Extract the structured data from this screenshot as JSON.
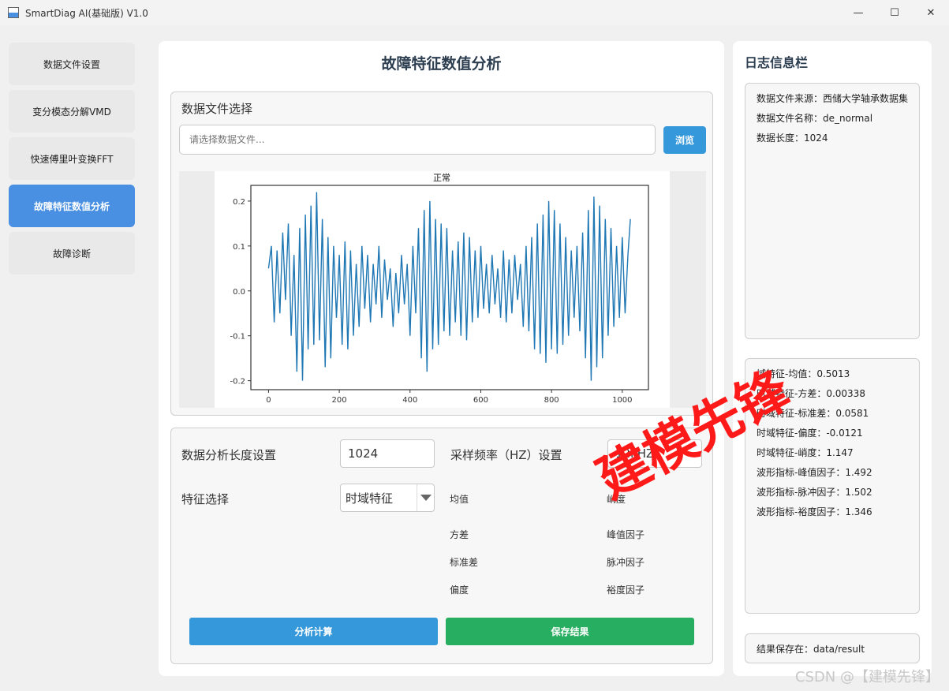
{
  "window": {
    "title": "SmartDiag AI(基础版) V1.0",
    "minimize": "—",
    "maximize": "☐",
    "close": "✕"
  },
  "sidebar": {
    "items": [
      {
        "label": "数据文件设置",
        "active": false
      },
      {
        "label": "变分模态分解VMD",
        "active": false
      },
      {
        "label": "快速傅里叶变换FFT",
        "active": false
      },
      {
        "label": "故障特征数值分析",
        "active": true
      },
      {
        "label": "故障诊断",
        "active": false
      }
    ]
  },
  "main": {
    "title": "故障特征数值分析",
    "file_section": {
      "title": "数据文件选择",
      "input_placeholder": "请选择数据文件...",
      "browse_label": "浏览"
    },
    "settings": {
      "length_label": "数据分析长度设置",
      "length_value": "1024",
      "freq_label": "采样频率（HZ）设置",
      "freq_value": "12kHZ",
      "feature_label": "特征选择",
      "feature_selected": "时域特征",
      "features_left": [
        "均值",
        "方差",
        "标准差",
        "偏度"
      ],
      "features_right": [
        "峭度",
        "峰值因子",
        "脉冲因子",
        "裕度因子"
      ],
      "analyze_label": "分析计算",
      "save_label": "保存结果"
    }
  },
  "log": {
    "title": "日志信息栏",
    "file_info": [
      "数据文件来源：西储大学轴承数据集",
      "数据文件名称：de_normal",
      "数据长度：1024"
    ],
    "results": [
      "域特征-均值：0.5013",
      "时域特征-方差：0.00338",
      "时域特征-标准差：0.0581",
      "时域特征-偏度：-0.0121",
      "时域特征-峭度：1.147",
      "波形指标-峰值因子：1.492",
      "波形指标-脉冲因子：1.502",
      "波形指标-裕度因子：1.346"
    ],
    "save_path": "结果保存在：data/result"
  },
  "watermark": "建模先锋",
  "csdn_mark": "CSDN @【建模先锋】",
  "colors": {
    "primary": "#3498db",
    "active_nav": "#4a90e2",
    "save": "#27ae60",
    "line": "#1f77b4"
  },
  "chart_data": {
    "type": "line",
    "title": "正常",
    "xlabel": "",
    "ylabel": "",
    "xlim": [
      -50,
      1074
    ],
    "ylim": [
      -0.22,
      0.235
    ],
    "xticks": [
      0,
      200,
      400,
      600,
      800,
      1000
    ],
    "yticks": [
      0.2,
      0.1,
      0.0,
      -0.1,
      -0.2
    ],
    "x": [
      0,
      8,
      16,
      24,
      32,
      40,
      48,
      56,
      64,
      72,
      80,
      88,
      96,
      104,
      112,
      120,
      128,
      136,
      144,
      152,
      160,
      168,
      176,
      184,
      192,
      200,
      208,
      216,
      224,
      232,
      240,
      248,
      256,
      264,
      272,
      280,
      288,
      296,
      304,
      312,
      320,
      328,
      336,
      344,
      352,
      360,
      368,
      376,
      384,
      392,
      400,
      408,
      416,
      424,
      432,
      440,
      448,
      456,
      464,
      472,
      480,
      488,
      496,
      504,
      512,
      520,
      528,
      536,
      544,
      552,
      560,
      568,
      576,
      584,
      592,
      600,
      608,
      616,
      624,
      632,
      640,
      648,
      656,
      664,
      672,
      680,
      688,
      696,
      704,
      712,
      720,
      728,
      736,
      744,
      752,
      760,
      768,
      776,
      784,
      792,
      800,
      808,
      816,
      824,
      832,
      840,
      848,
      856,
      864,
      872,
      880,
      888,
      896,
      904,
      912,
      920,
      928,
      936,
      944,
      952,
      960,
      968,
      976,
      984,
      992,
      1000,
      1008,
      1016,
      1023
    ],
    "y": [
      0.05,
      0.1,
      -0.07,
      0.09,
      -0.05,
      0.13,
      -0.02,
      0.15,
      -0.1,
      0.08,
      -0.18,
      0.14,
      -0.2,
      0.17,
      -0.13,
      0.19,
      -0.12,
      0.22,
      -0.11,
      0.16,
      -0.17,
      0.12,
      -0.15,
      0.1,
      -0.06,
      0.08,
      -0.12,
      0.11,
      -0.13,
      0.09,
      -0.1,
      0.06,
      -0.08,
      0.1,
      -0.04,
      0.08,
      -0.07,
      0.06,
      -0.03,
      0.1,
      -0.06,
      0.07,
      -0.02,
      0.05,
      -0.08,
      0.04,
      -0.05,
      0.08,
      -0.03,
      0.06,
      -0.1,
      0.1,
      -0.05,
      0.14,
      -0.15,
      0.18,
      -0.18,
      0.2,
      -0.13,
      0.16,
      -0.12,
      0.15,
      -0.09,
      0.14,
      -0.1,
      0.09,
      -0.07,
      0.11,
      -0.1,
      0.13,
      -0.11,
      0.12,
      -0.07,
      0.09,
      -0.06,
      0.1,
      -0.04,
      0.06,
      -0.05,
      0.08,
      -0.03,
      0.05,
      -0.06,
      0.09,
      -0.07,
      0.07,
      -0.05,
      0.08,
      -0.02,
      0.06,
      -0.08,
      0.1,
      -0.09,
      0.12,
      -0.13,
      0.15,
      -0.14,
      0.17,
      -0.16,
      0.2,
      -0.13,
      0.18,
      -0.14,
      0.15,
      -0.12,
      0.12,
      -0.1,
      0.09,
      -0.06,
      0.1,
      -0.09,
      0.13,
      -0.15,
      0.18,
      -0.2,
      0.21,
      -0.17,
      0.19,
      -0.15,
      0.16,
      -0.1,
      0.14,
      -0.08,
      0.1,
      -0.06,
      0.12,
      -0.05,
      0.08,
      0.16
    ]
  }
}
